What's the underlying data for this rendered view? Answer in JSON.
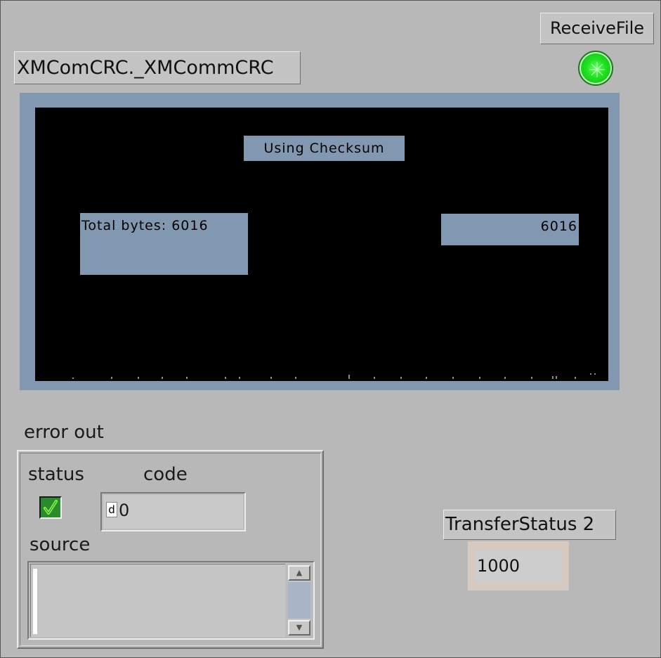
{
  "header": {
    "receive_button_label": "ReceiveFile",
    "vi_title": "XMComCRC._XMCommCRC",
    "led_state": "on",
    "led_color": "#22e222"
  },
  "graph": {
    "frame_color": "#8298b0",
    "plot_bg": "#000000",
    "mode_label": "Using Checksum",
    "total_label": "Total bytes: 6016",
    "total_value": "6016"
  },
  "error_out": {
    "label": "error out",
    "status_label": "status",
    "status_value": true,
    "code_label": "code",
    "code_radix": "d",
    "code_value": "0",
    "source_label": "source",
    "source_value": ""
  },
  "transfer_status": {
    "label": "TransferStatus 2",
    "value": "1000"
  },
  "icons": {
    "check": "check-icon",
    "scroll_up": "arrow-up-icon",
    "scroll_down": "arrow-down-icon"
  }
}
